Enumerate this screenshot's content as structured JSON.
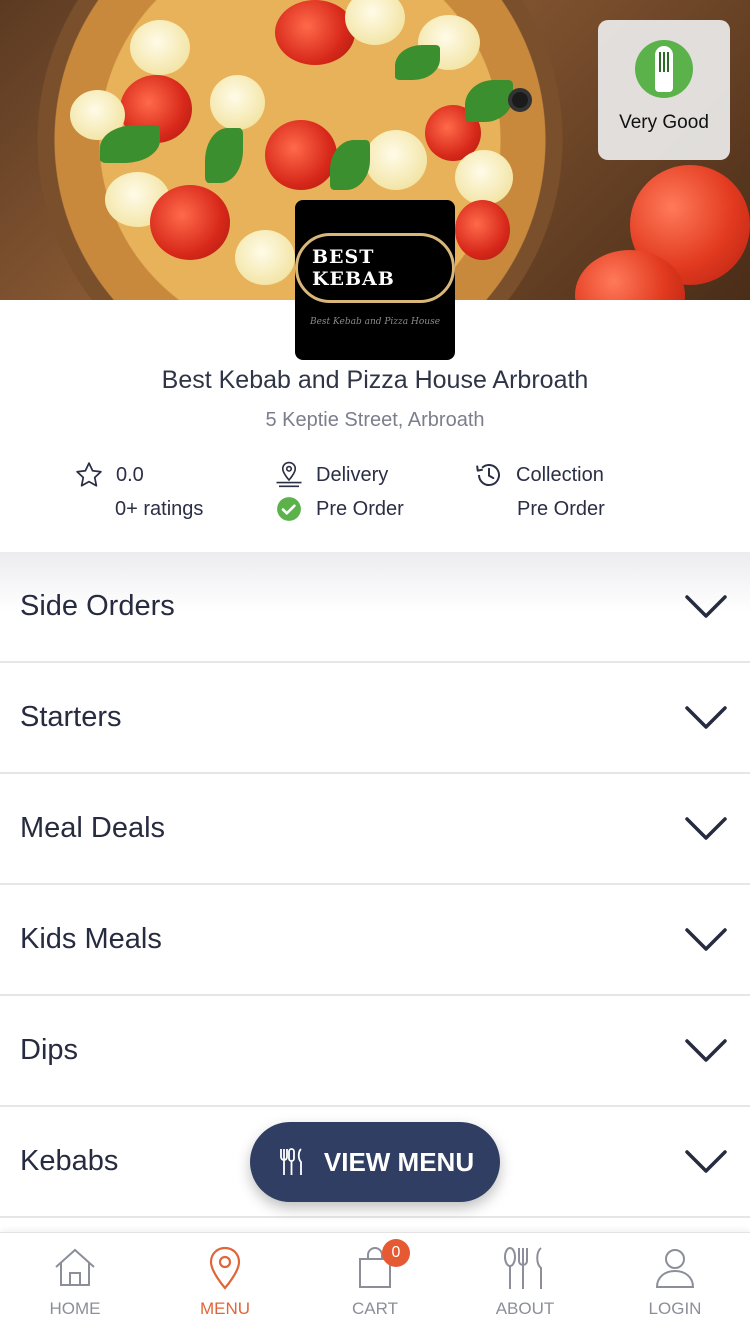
{
  "header": {
    "rating_badge_label": "Very Good",
    "logo_title": "BEST KEBAB",
    "logo_subtitle": "Best Kebab and Pizza House"
  },
  "shop": {
    "name": "Best Kebab and Pizza House Arbroath",
    "address": "5 Keptie Street, Arbroath",
    "rating_value": "0.0",
    "rating_count": "0+ ratings",
    "delivery_label": "Delivery",
    "delivery_status": "Pre Order",
    "collection_label": "Collection",
    "collection_status": "Pre Order"
  },
  "categories": [
    {
      "label": "Side Orders"
    },
    {
      "label": "Starters"
    },
    {
      "label": "Meal Deals"
    },
    {
      "label": "Kids Meals"
    },
    {
      "label": "Dips"
    },
    {
      "label": "Kebabs"
    }
  ],
  "view_menu_button": "VIEW MENU",
  "tabbar": {
    "items": [
      {
        "label": "HOME",
        "icon": "home-icon"
      },
      {
        "label": "MENU",
        "icon": "location-pin-icon"
      },
      {
        "label": "CART",
        "icon": "shopping-bag-icon"
      },
      {
        "label": "ABOUT",
        "icon": "cutlery-icon"
      },
      {
        "label": "LOGIN",
        "icon": "user-icon"
      }
    ],
    "active_index": 1,
    "cart_count": "0"
  },
  "colors": {
    "accent": "#e0663a",
    "button": "#2f3e62",
    "success": "#5bb24a",
    "text": "#2a2f45"
  }
}
